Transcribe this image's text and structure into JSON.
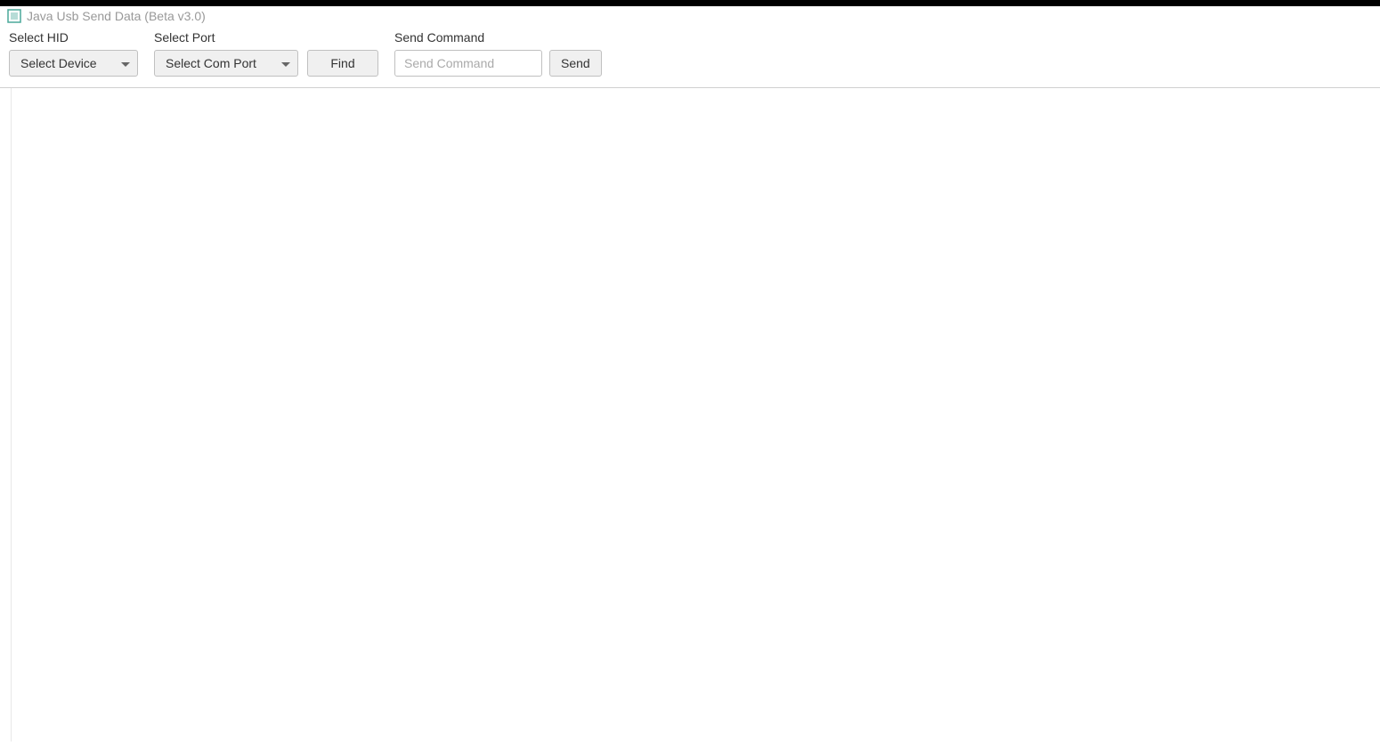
{
  "window": {
    "title": "Java Usb Send Data (Beta v3.0)"
  },
  "toolbar": {
    "hid": {
      "label": "Select HID",
      "dropdown_value": "Select Device"
    },
    "port": {
      "label": "Select Port",
      "dropdown_value": "Select Com Port",
      "find_label": "Find"
    },
    "command": {
      "label": "Send Command",
      "input_placeholder": "Send Command",
      "input_value": "",
      "send_label": "Send"
    }
  }
}
